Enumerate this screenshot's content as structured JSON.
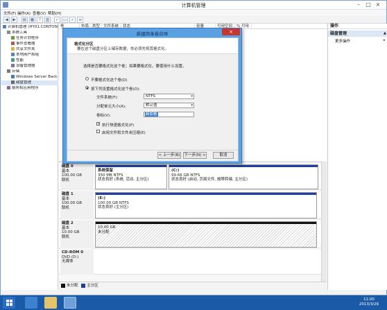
{
  "window": {
    "title": "计算机管理"
  },
  "menu": [
    "文件(F)",
    "操作(A)",
    "查看(V)",
    "帮助(H)"
  ],
  "tree": [
    {
      "label": "计算机管理 (HY01.CONTOSO",
      "level": 0,
      "icon": "computer-icon"
    },
    {
      "label": "系统工具",
      "level": 1,
      "icon": "tools-icon"
    },
    {
      "label": "任务计划程序",
      "level": 2,
      "icon": "clock-icon"
    },
    {
      "label": "事件查看器",
      "level": 2,
      "icon": "event-icon"
    },
    {
      "label": "共享文件夹",
      "level": 2,
      "icon": "folder-icon"
    },
    {
      "label": "本地用户和组",
      "level": 2,
      "icon": "users-icon"
    },
    {
      "label": "性能",
      "level": 2,
      "icon": "performance-icon"
    },
    {
      "label": "设备管理器",
      "level": 2,
      "icon": "device-icon"
    },
    {
      "label": "存储",
      "level": 1,
      "icon": "storage-icon"
    },
    {
      "label": "Windows Server Back",
      "level": 2,
      "icon": "backup-icon"
    },
    {
      "label": "磁盘管理",
      "level": 2,
      "icon": "disk-icon"
    },
    {
      "label": "服务和应用程序",
      "level": 1,
      "icon": "services-icon"
    }
  ],
  "list_headers": [
    "卷",
    "布局",
    "类型",
    "文件系统",
    "状态",
    "容量",
    "可用空间",
    "% 可用"
  ],
  "list_rows_visible_pct": [
    "%",
    "%",
    "%"
  ],
  "disks": [
    {
      "name": "磁盘 0",
      "type": "基本",
      "size": "100.00 GB",
      "state": "联机",
      "partitions": [
        {
          "name": "系统保留",
          "detail": "350 MB NTFS",
          "status": "状态良好 (系统, 活动, 主分区)",
          "kind": "primary"
        },
        {
          "name": "(C:)",
          "detail": "99.66 GB NTFS",
          "status": "状态良好 (启动, 页面文件, 故障转储, 主分区)",
          "kind": "primary"
        }
      ]
    },
    {
      "name": "磁盘 1",
      "type": "基本",
      "size": "100.00 GB",
      "state": "联机",
      "partitions": [
        {
          "name": "(E:)",
          "detail": "100.00 GB NTFS",
          "status": "状态良好 (主分区)",
          "kind": "primary"
        }
      ]
    },
    {
      "name": "磁盘 2",
      "type": "基本",
      "size": "10.00 GB",
      "state": "联机",
      "partitions": [
        {
          "name": "",
          "detail": "10.00 GB",
          "status": "未分配",
          "kind": "unallocated"
        }
      ]
    },
    {
      "name": "CD-ROM 0",
      "type": "DVD (D:)",
      "size": "",
      "state": "无媒体",
      "partitions": []
    }
  ],
  "legend": [
    {
      "label": "未分配",
      "color": "#111111"
    },
    {
      "label": "主分区",
      "color": "#1f3fa3"
    }
  ],
  "actions": {
    "title": "操作",
    "section": "磁盘管理",
    "more": "更多操作"
  },
  "wizard": {
    "title": "新建简单卷向导",
    "heading": "格式化分区",
    "subheading": "要在这个磁盘分区上储存数据，你必须先将其格式化。",
    "prompt": "选择是否要格式化这个卷；如果要格式化，要使用什么设置。",
    "option_no": "不要格式化这个卷(D)",
    "option_yes": "按下列设置格式化这个卷(O):",
    "fs_label": "文件系统(F):",
    "fs_value": "NTFS",
    "alloc_label": "分配单元大小(A):",
    "alloc_value": "默认值",
    "vol_label": "卷标(V):",
    "vol_value": "新加卷",
    "quick_format": "执行快速格式化(P)",
    "compression": "启用文件和文件夹压缩(E)",
    "back": "< 上一步(B)",
    "next": "下一步(N) >",
    "cancel": "取消"
  },
  "clock": {
    "time": "11:00",
    "date": "2013/3/26"
  },
  "colors": {
    "primary_partition": "#1f3fa3",
    "taskbar": "#1b5aa6",
    "dialog_frame": "#5aa1e3"
  }
}
